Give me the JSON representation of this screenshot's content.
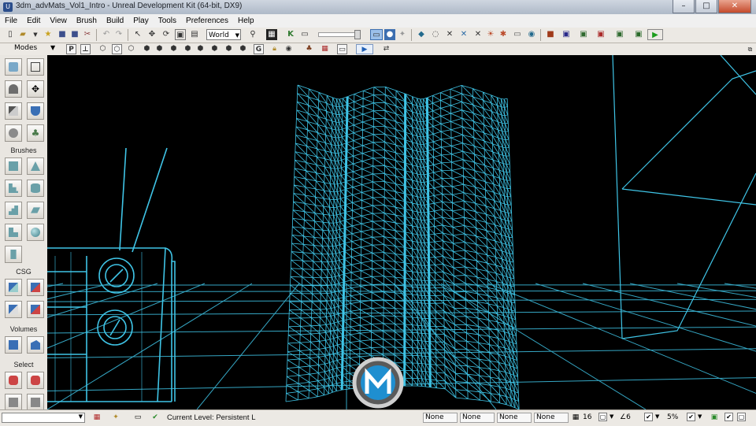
{
  "window": {
    "title": "3dm_advMats_Vol1_Intro - Unreal Development Kit (64-bit, DX9)",
    "minimize_glyph": "–",
    "maximize_glyph": "□",
    "close_glyph": "✕"
  },
  "menu": [
    "File",
    "Edit",
    "View",
    "Brush",
    "Build",
    "Play",
    "Tools",
    "Preferences",
    "Help"
  ],
  "toolbar": {
    "coordinate_system": "World"
  },
  "modes_bar": {
    "label": "Modes"
  },
  "palette": {
    "sections": [
      "Brushes",
      "CSG",
      "Volumes",
      "Select"
    ]
  },
  "status": {
    "current_level_label": "Current Level:",
    "current_level": "Persistent L",
    "field_1": "None",
    "field_2": "None",
    "field_3": "None",
    "field_4": "None",
    "grid_size": "16",
    "rotation_snap": "∠6",
    "scale_snap": "5%"
  },
  "colors": {
    "wire": "#3fc4e6",
    "viewport_bg": "#000000",
    "chrome": "#ece9e4"
  },
  "icons": {
    "toolbar": [
      "new-file-icon",
      "open-folder-icon",
      "save-icon",
      "undo-icon",
      "redo-icon",
      "select-arrow-icon",
      "translate-icon",
      "rotate-icon",
      "scale-icon",
      "binoculars-icon",
      "build-icon",
      "play-icon"
    ],
    "viewport": [
      "perspective-icon",
      "wireframe-icon",
      "unlit-icon",
      "lit-icon",
      "lock-icon",
      "eye-icon",
      "realtime-icon",
      "play-in-viewport-icon"
    ]
  }
}
